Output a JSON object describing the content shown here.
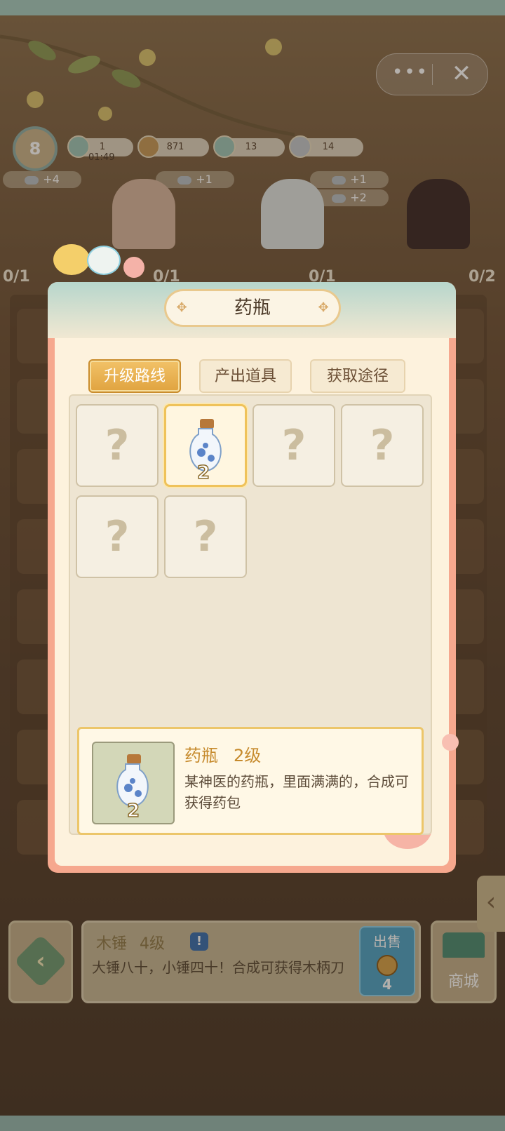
{
  "capsule": {
    "more_label": "•••",
    "close_label": "✕"
  },
  "hud": {
    "level": "8",
    "resources": [
      {
        "value": "1",
        "icon": "spirit-icon"
      },
      {
        "value": "871",
        "icon": "coin-icon"
      },
      {
        "value": "13",
        "icon": "leaf-icon"
      },
      {
        "value": "14",
        "icon": "silver-ingot-icon"
      }
    ],
    "timer": "01:49",
    "bonus_pills": [
      "+4",
      "+1",
      "+1",
      "+2"
    ],
    "slot_counts": [
      "0/1",
      "0/1",
      "0/1",
      "0/2"
    ]
  },
  "modal": {
    "title": "药瓶",
    "tabs": [
      "升级路线",
      "产出道具",
      "获取途径"
    ],
    "active_tab": "升级路线",
    "cells": [
      {
        "type": "unknown",
        "symbol": "?"
      },
      {
        "type": "item",
        "level": "2"
      },
      {
        "type": "unknown",
        "symbol": "?"
      },
      {
        "type": "unknown",
        "symbol": "?"
      },
      {
        "type": "unknown",
        "symbol": "?"
      },
      {
        "type": "unknown",
        "symbol": "?"
      }
    ],
    "detail": {
      "name": "药瓶",
      "level": "2级",
      "thumb_level": "2",
      "description": "某神医的药瓶，里面满满的，合成可获得药包"
    }
  },
  "bottom_bar": {
    "back_icon": "‹",
    "item_name": "木锤",
    "item_level": "4级",
    "info_label": "!",
    "item_description": "大锤八十，小锤四十！合成可获得木柄刀",
    "sell_label": "出售",
    "sell_price": "4",
    "shop_label": "商城",
    "side_tab_icon": "‹"
  },
  "colors": {
    "modal_border": "#f6a88e",
    "active_tab": "#e0a33f",
    "detail_title": "#c68a2c",
    "sell_button": "#4fa3c6"
  }
}
